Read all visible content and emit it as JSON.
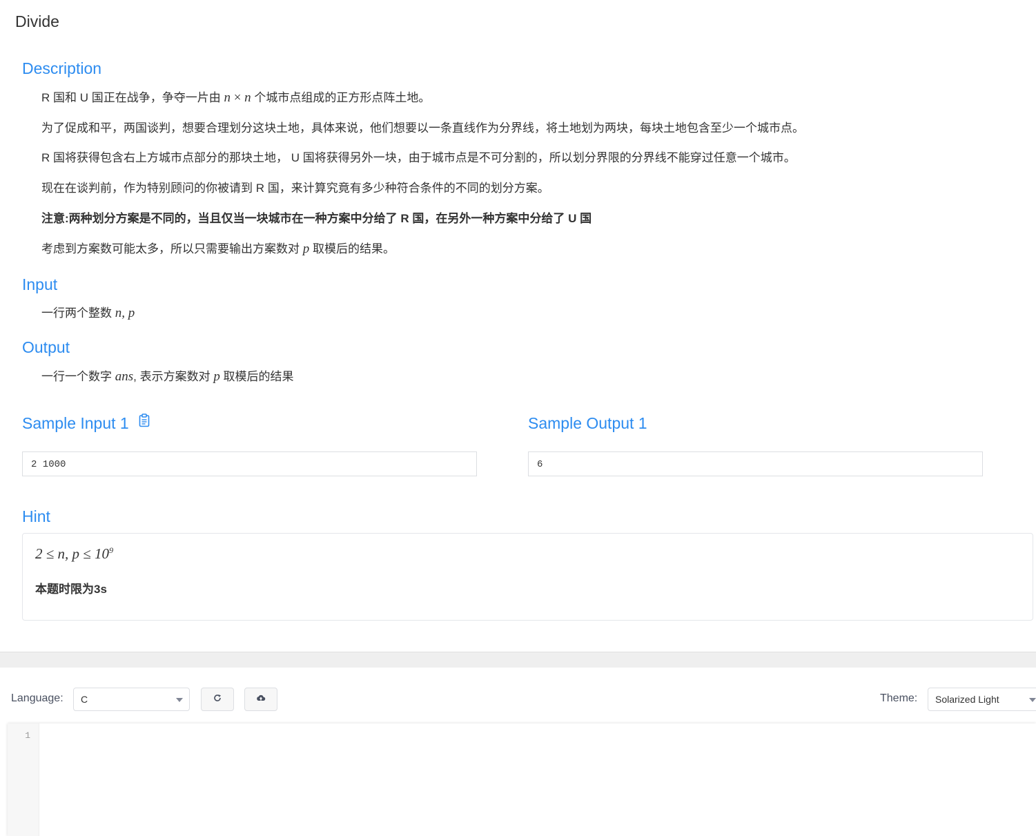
{
  "problem": {
    "title": "Divide",
    "description_heading": "Description",
    "desc": {
      "p1_pre": "R 国和 U 国正在战争，争夺一片由 ",
      "p1_math_a": "n",
      "p1_math_times": "×",
      "p1_math_b": "n",
      "p1_post": " 个城市点组成的正方形点阵土地。",
      "p2": "为了促成和平，两国谈判，想要合理划分这块土地，具体来说，他们想要以一条直线作为分界线，将土地划为两块，每块土地包含至少一个城市点。",
      "p3": "R 国将获得包含右上方城市点部分的那块土地， U 国将获得另外一块，由于城市点是不可分割的，所以划分界限的分界线不能穿过任意一个城市。",
      "p4": "现在在谈判前，作为特别顾问的你被请到 R 国，来计算究竟有多少种符合条件的不同的划分方案。",
      "p5_bold": "注意:两种划分方案是不同的，当且仅当一块城市在一种方案中分给了 R 国，在另外一种方案中分给了 U 国",
      "p6_pre": "考虑到方案数可能太多，所以只需要输出方案数对 ",
      "p6_math": "p",
      "p6_post": " 取模后的结果。"
    },
    "input_heading": "Input",
    "input_pre": "一行两个整数 ",
    "input_math": "n, p",
    "output_heading": "Output",
    "output_pre": "一行一个数字 ",
    "output_math": "ans",
    "output_mid": ", 表示方案数对 ",
    "output_math_p": "p",
    "output_post": " 取模后的结果",
    "samples": [
      {
        "input_heading": "Sample Input 1",
        "output_heading": "Sample Output 1",
        "input": "2 1000",
        "output": "6"
      }
    ],
    "hint_heading": "Hint",
    "hint_math": "2 ≤ n, p ≤ 10",
    "hint_math_exp": "9",
    "hint_bold": "本题时限为3s"
  },
  "editor": {
    "language_label": "Language:",
    "language_value": "C",
    "theme_label": "Theme:",
    "theme_value": "Solarized Light",
    "line_number": "1"
  },
  "icons": {
    "copy": "clipboard-icon",
    "reset": "refresh-icon",
    "upload": "cloud-upload-icon"
  },
  "colors": {
    "accent": "#2d8cf0",
    "text": "#333333"
  }
}
